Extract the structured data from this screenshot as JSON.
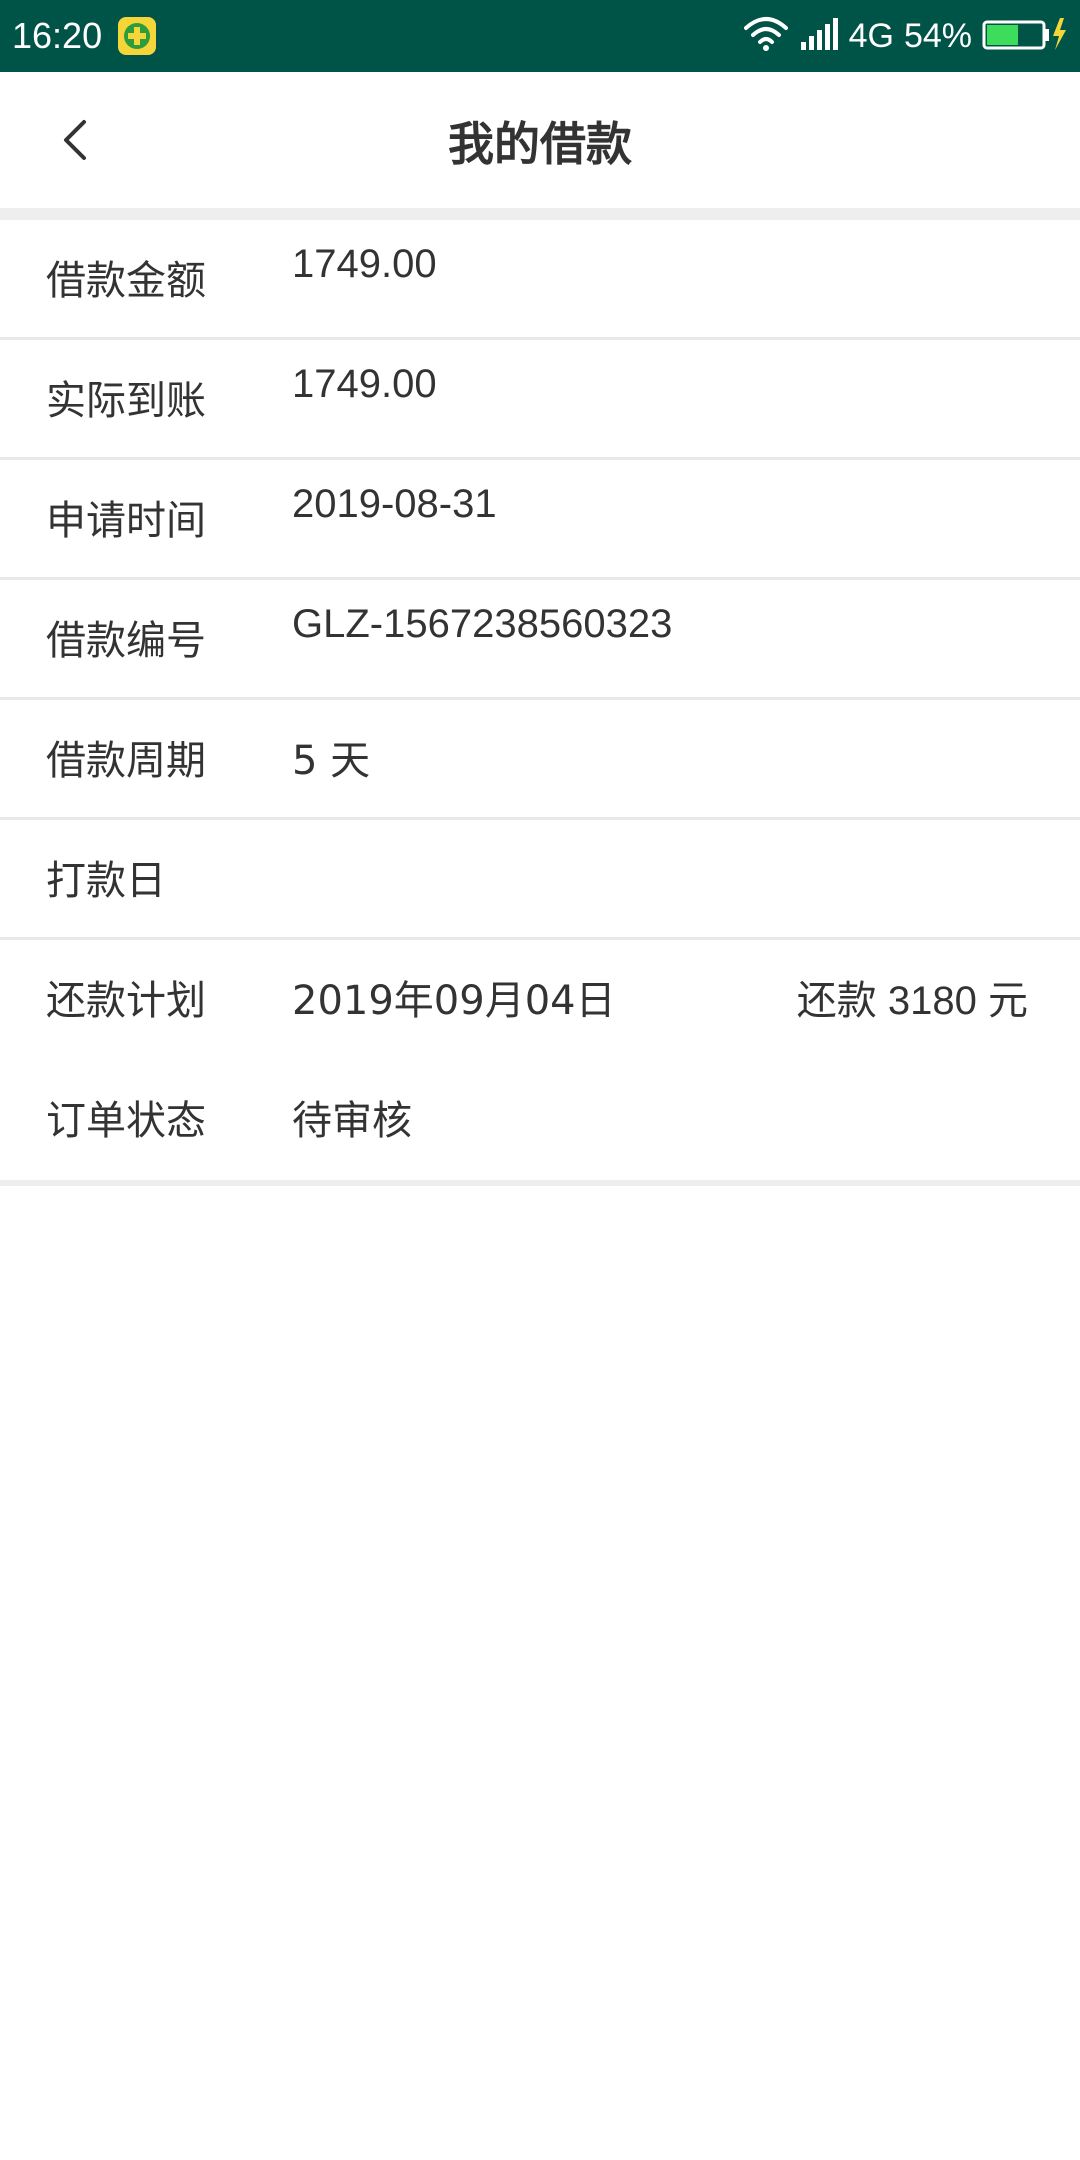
{
  "status_bar": {
    "time": "16:20",
    "network": "4G",
    "battery": "54%"
  },
  "header": {
    "title": "我的借款",
    "back_icon": "chevron-left-icon"
  },
  "details": {
    "loan_amount": {
      "label": "借款金额",
      "value": "1749.00"
    },
    "actual_received": {
      "label": "实际到账",
      "value": "1749.00"
    },
    "apply_time": {
      "label": "申请时间",
      "value": "2019-08-31"
    },
    "loan_number": {
      "label": "借款编号",
      "value": "GLZ-1567238560323"
    },
    "loan_period": {
      "label": "借款周期",
      "value": "5 天"
    },
    "payment_date": {
      "label": "打款日",
      "value": ""
    },
    "repayment_plan": {
      "label": "还款计划",
      "value": "2019年09月04日",
      "extra": "还款 3180 元"
    },
    "order_status": {
      "label": "订单状态",
      "value": "待审核"
    }
  },
  "colors": {
    "status_bar_bg": "#005447",
    "text": "#333333",
    "divider": "#e8e8e8"
  }
}
